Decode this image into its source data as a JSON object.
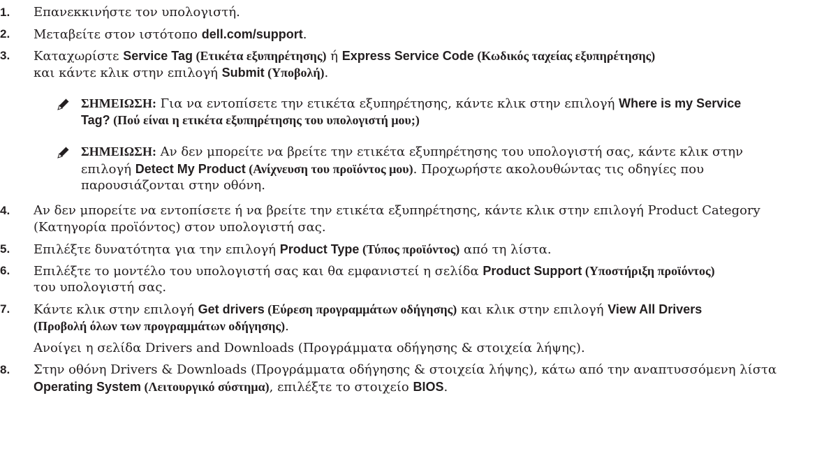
{
  "steps": [
    {
      "num": "1.",
      "text": "Επανεκκινήστε τον υπολογιστή."
    },
    {
      "num": "2.",
      "a": "Μεταβείτε στον ιστότοπο ",
      "b": "dell.com/support",
      "c": "."
    },
    {
      "num": "3.",
      "a": "Καταχωρίστε ",
      "b": "Service Tag",
      "c": " (Ετικέτα εξυπηρέτησης)",
      "d": " ή ",
      "e": "Express Service Code",
      "f": " (Κωδικός ταχείας εξυπηρέτησης)",
      "g": "και κάντε κλικ στην επιλογή ",
      "h": "Submit",
      "i": " (Υποβολή)",
      "j": "."
    },
    {
      "num": "4.",
      "l1": "Αν δεν μπορείτε να εντοπίσετε ή να βρείτε την ετικέτα εξυπηρέτησης, κάντε κλικ στην επιλογή Product Category",
      "l2": "(Κατηγορία προϊόντος) στον υπολογιστή σας."
    },
    {
      "num": "5.",
      "a": "Επιλέξτε δυνατότητα για την επιλογή ",
      "b": "Product Type",
      "c": " (Τύπος προϊόντος)",
      "d": " από τη λίστα."
    },
    {
      "num": "6.",
      "a": "Επιλέξτε το μοντέλο του υπολογιστή σας και θα εμφανιστεί η σελίδα ",
      "b": "Product Support",
      "c": " (Υποστήριξη προϊόντος)",
      "l2": "του υπολογιστή σας."
    },
    {
      "num": "7.",
      "a": "Κάντε κλικ στην επιλογή ",
      "b": "Get drivers",
      "c": " (Εύρεση προγραμμάτων οδήγησης)",
      "d": " και κλικ στην επιλογή ",
      "e": "View All Drivers",
      "l2": "(Προβολή όλων των προγραμμάτων οδήγησης)",
      "l2end": ".",
      "l3": "Ανοίγει η σελίδα Drivers and Downloads (Προγράμματα οδήγησης & στοιχεία λήψης)."
    },
    {
      "num": "8.",
      "l1": "Στην οθόνη Drivers & Downloads (Προγράμματα οδήγησης & στοιχεία λήψης), κάτω από την αναπτυσσόμενη λίστα",
      "b": "Operating System",
      "c": " (Λειτουργικό σύστημα)",
      "d": ", επιλέξτε το στοιχείο ",
      "e": "BIOS",
      "f": "."
    }
  ],
  "notes": [
    {
      "label": "ΣΗΜΕΙΩΣΗ:",
      "a": " Για να εντοπίσετε την ετικέτα εξυπηρέτησης, κάντε κλικ στην επιλογή ",
      "b": "Where is my Service",
      "l2b": "Tag?",
      "l2c": " (Πού είναι η ετικέτα εξυπηρέτησης του υπολογιστή μου;)"
    },
    {
      "label": "ΣΗΜΕΙΩΣΗ:",
      "a": " Αν δεν μπορείτε να βρείτε την ετικέτα εξυπηρέτησης του υπολογιστή σας, κάντε κλικ στην",
      "l2a": "επιλογή ",
      "l2b": "Detect My Product",
      "l2c": " (Ανίχνευση του προϊόντος μου)",
      "l2d": ". Προχωρήστε ακολουθώντας τις οδηγίες που",
      "l3": "παρουσιάζονται στην οθόνη."
    }
  ],
  "icons": {
    "note": "pencil-note-icon"
  }
}
